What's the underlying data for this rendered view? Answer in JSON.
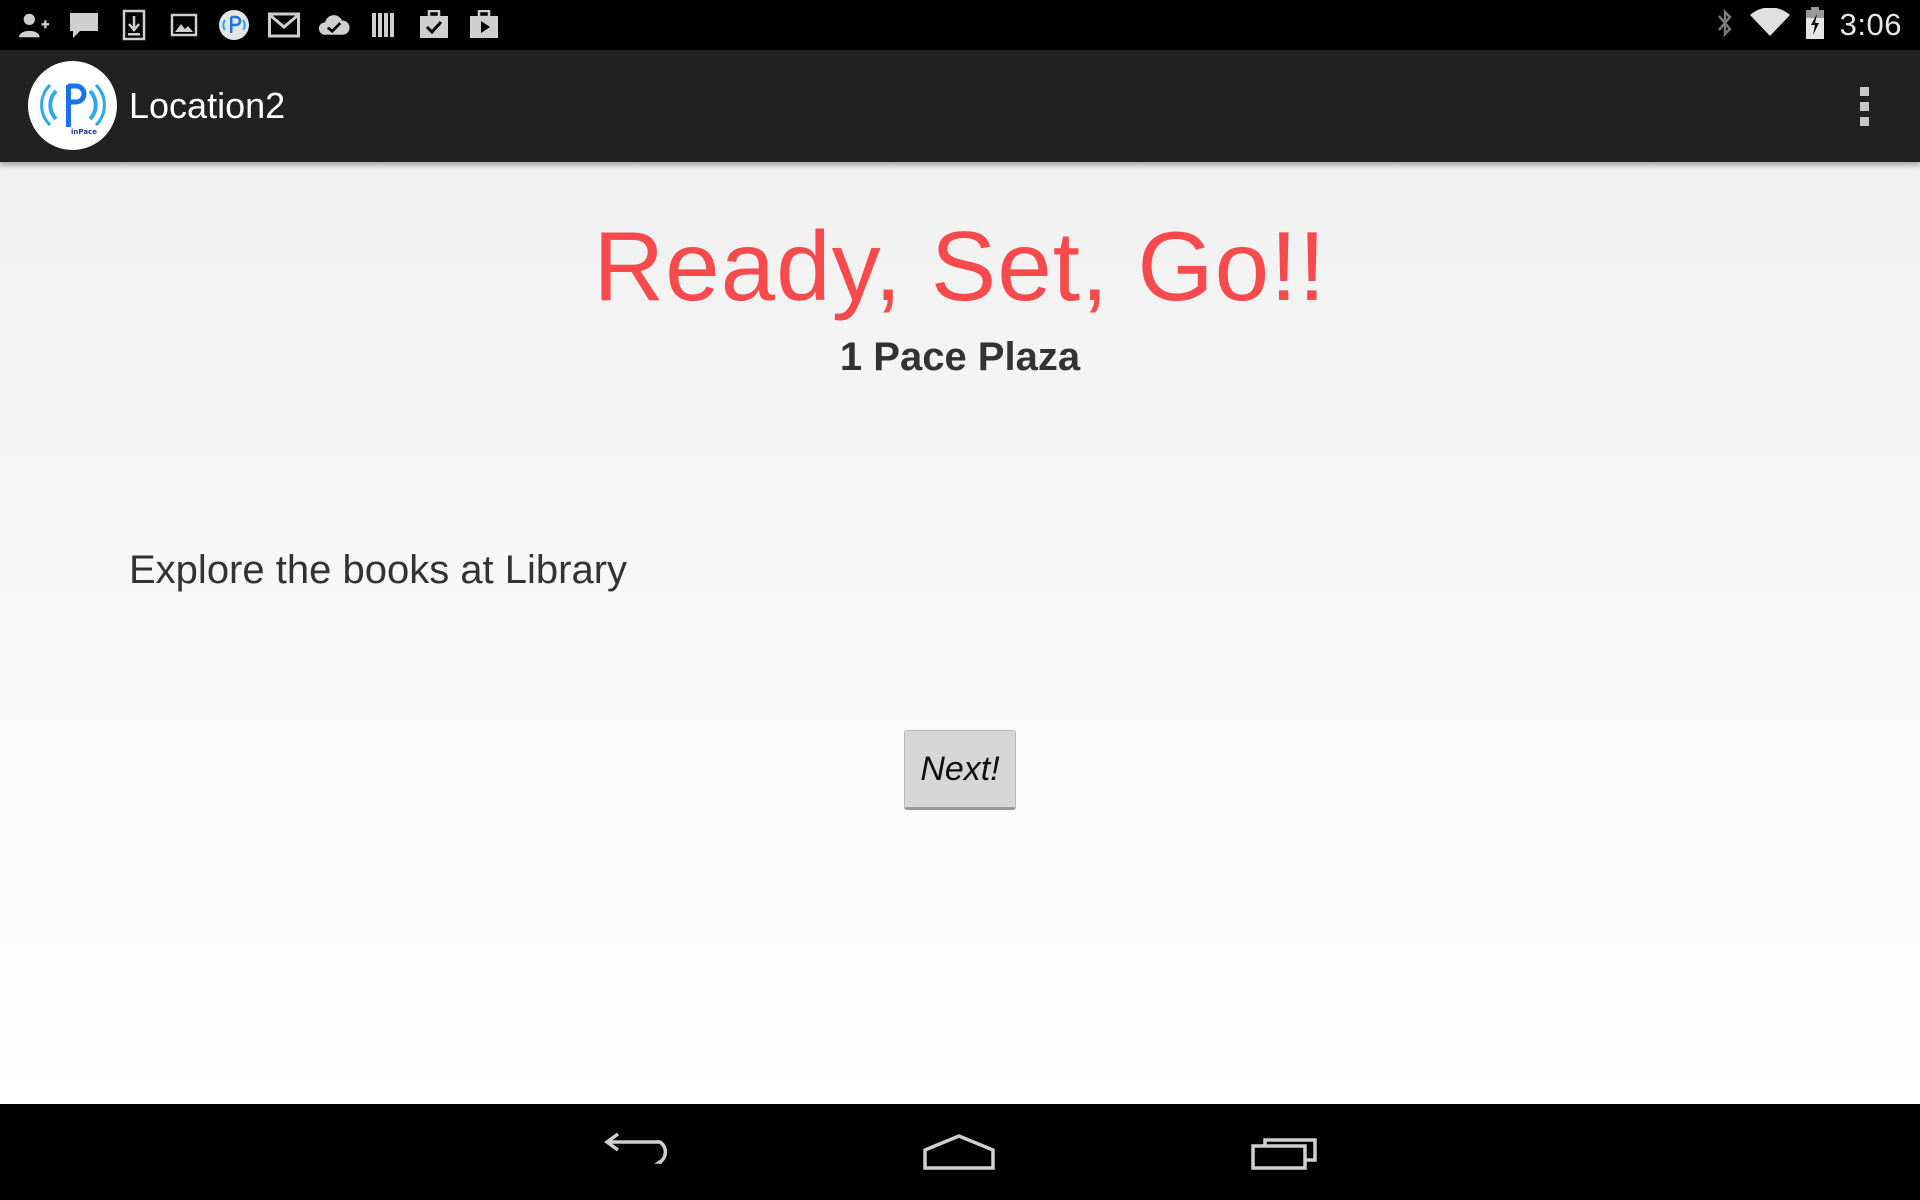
{
  "status_bar": {
    "notification_icons": [
      "add-contact-icon",
      "chat-icon",
      "download-icon",
      "image-icon",
      "inpace-app-icon",
      "gmail-icon",
      "cloud-check-icon",
      "library-icon",
      "task-check-icon",
      "play-store-icon"
    ],
    "system_icons": [
      "bluetooth-icon",
      "wifi-icon",
      "battery-charging-icon"
    ],
    "time": "3:06"
  },
  "action_bar": {
    "logo_icon": "inpace-logo-icon",
    "logo_text": "inPace",
    "title": "Location2",
    "overflow_icon": "more-vertical-icon"
  },
  "content": {
    "headline": "Ready, Set, Go!!",
    "address": "1 Pace Plaza",
    "instruction": "Explore the books at Library",
    "next_button_label": "Next!"
  },
  "nav_bar": {
    "buttons": [
      "back-icon",
      "home-icon",
      "recent-apps-icon"
    ]
  },
  "colors": {
    "headline": "#f64a4c",
    "action_bar": "#212121",
    "logo_blue": "#1a73e8",
    "logo_light_blue": "#29a9f2"
  }
}
